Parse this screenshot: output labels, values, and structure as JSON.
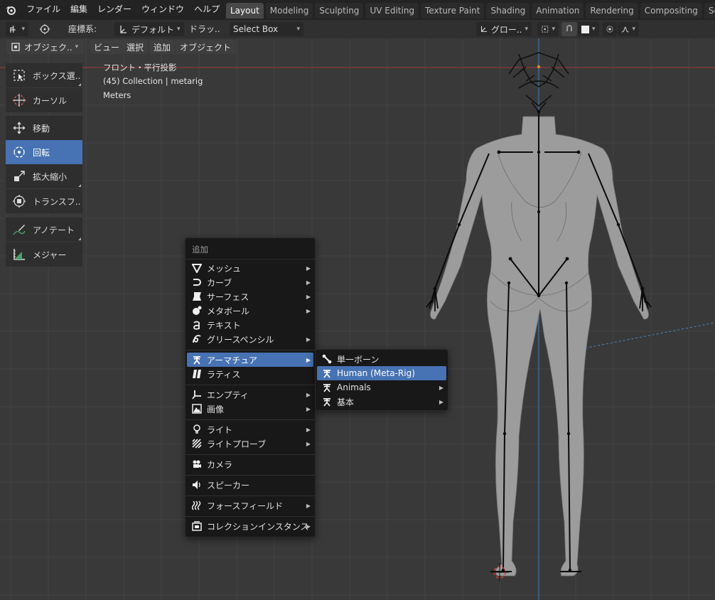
{
  "topbar": {
    "menus": [
      "ファイル",
      "編集",
      "レンダー",
      "ウィンドウ",
      "ヘルプ"
    ],
    "workspace_tabs": [
      "Layout",
      "Modeling",
      "Sculpting",
      "UV Editing",
      "Texture Paint",
      "Shading",
      "Animation",
      "Rendering",
      "Compositing",
      "Scripting"
    ],
    "active_tab": "Layout"
  },
  "header": {
    "coord_label": "座標系:",
    "orientation": "デフォルト",
    "drag_label": "ドラッ..",
    "drag_value": "Select Box",
    "pivot": "グロー..",
    "mode": "オブジェク..",
    "view_menus": [
      "ビュー",
      "選択",
      "追加",
      "オブジェクト"
    ]
  },
  "toolbar": {
    "tools": [
      "ボックス選..",
      "カーソル",
      "移動",
      "回転",
      "拡大縮小",
      "トランスフ..",
      "アノテート",
      "メジャー"
    ],
    "active_tool": "回転"
  },
  "viewport": {
    "view_name": "フロント・平行投影",
    "collection": "(45) Collection | metarig",
    "units": "Meters"
  },
  "add_menu": {
    "title": "追加",
    "items": [
      "メッシュ",
      "カーブ",
      "サーフェス",
      "メタボール",
      "テキスト",
      "グリースペンシル",
      "アーマチュア",
      "ラティス",
      "エンプティ",
      "画像",
      "ライト",
      "ライトプローブ",
      "カメラ",
      "スピーカー",
      "フォースフィールド",
      "コレクションインスタンス"
    ],
    "highlighted": "アーマチュア"
  },
  "armature_submenu": {
    "items": [
      "単一ボーン",
      "Human (Meta-Rig)",
      "Animals",
      "基本"
    ],
    "highlighted": "Human (Meta-Rig)"
  },
  "colors": {
    "accent": "#4772b3",
    "background": "#393939",
    "menu_bg": "#181818"
  }
}
